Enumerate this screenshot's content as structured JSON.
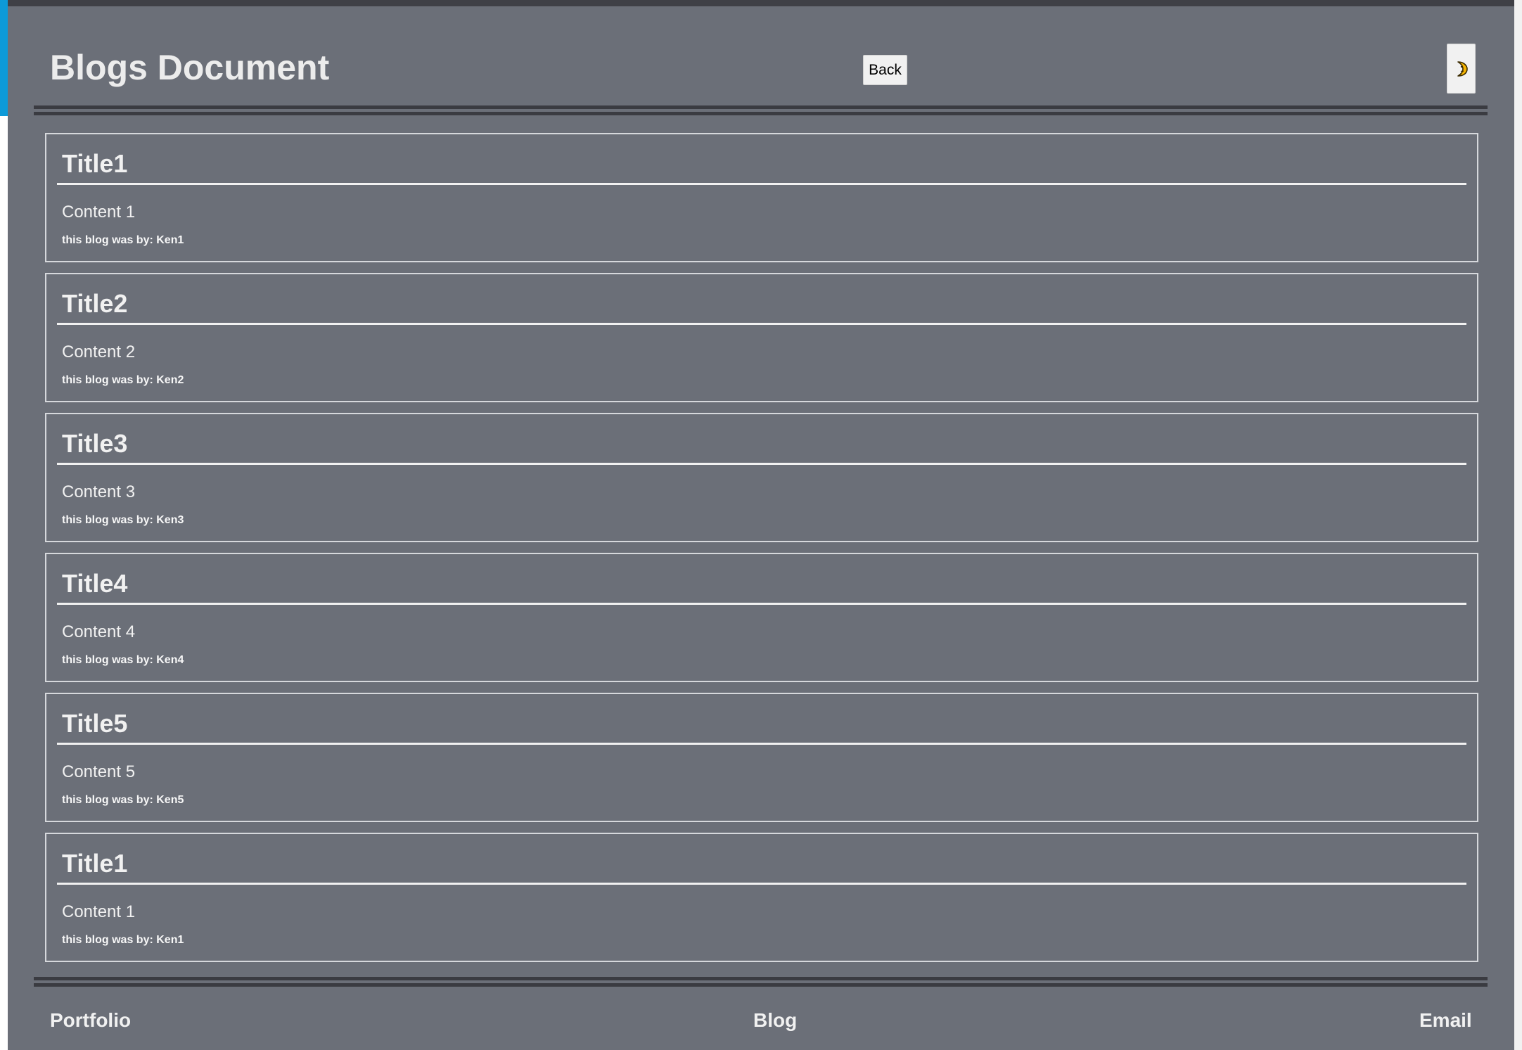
{
  "header": {
    "title": "Blogs Document",
    "back_label": "Back",
    "theme_icon": "crescent-moon-icon"
  },
  "blogs": [
    {
      "title": "Title1",
      "content": "Content 1",
      "author": "this blog was by: Ken1"
    },
    {
      "title": "Title2",
      "content": "Content 2",
      "author": "this blog was by: Ken2"
    },
    {
      "title": "Title3",
      "content": "Content 3",
      "author": "this blog was by: Ken3"
    },
    {
      "title": "Title4",
      "content": "Content 4",
      "author": "this blog was by: Ken4"
    },
    {
      "title": "Title5",
      "content": "Content 5",
      "author": "this blog was by: Ken5"
    },
    {
      "title": "Title1",
      "content": "Content 1",
      "author": "this blog was by: Ken1"
    }
  ],
  "footer": {
    "portfolio": "Portfolio",
    "blog": "Blog",
    "email": "Email"
  },
  "colors": {
    "page_bg": "#6b6f78",
    "accent_blue": "#0d9ad8",
    "rule": "#3a3b41",
    "text": "#f1f1f1"
  }
}
